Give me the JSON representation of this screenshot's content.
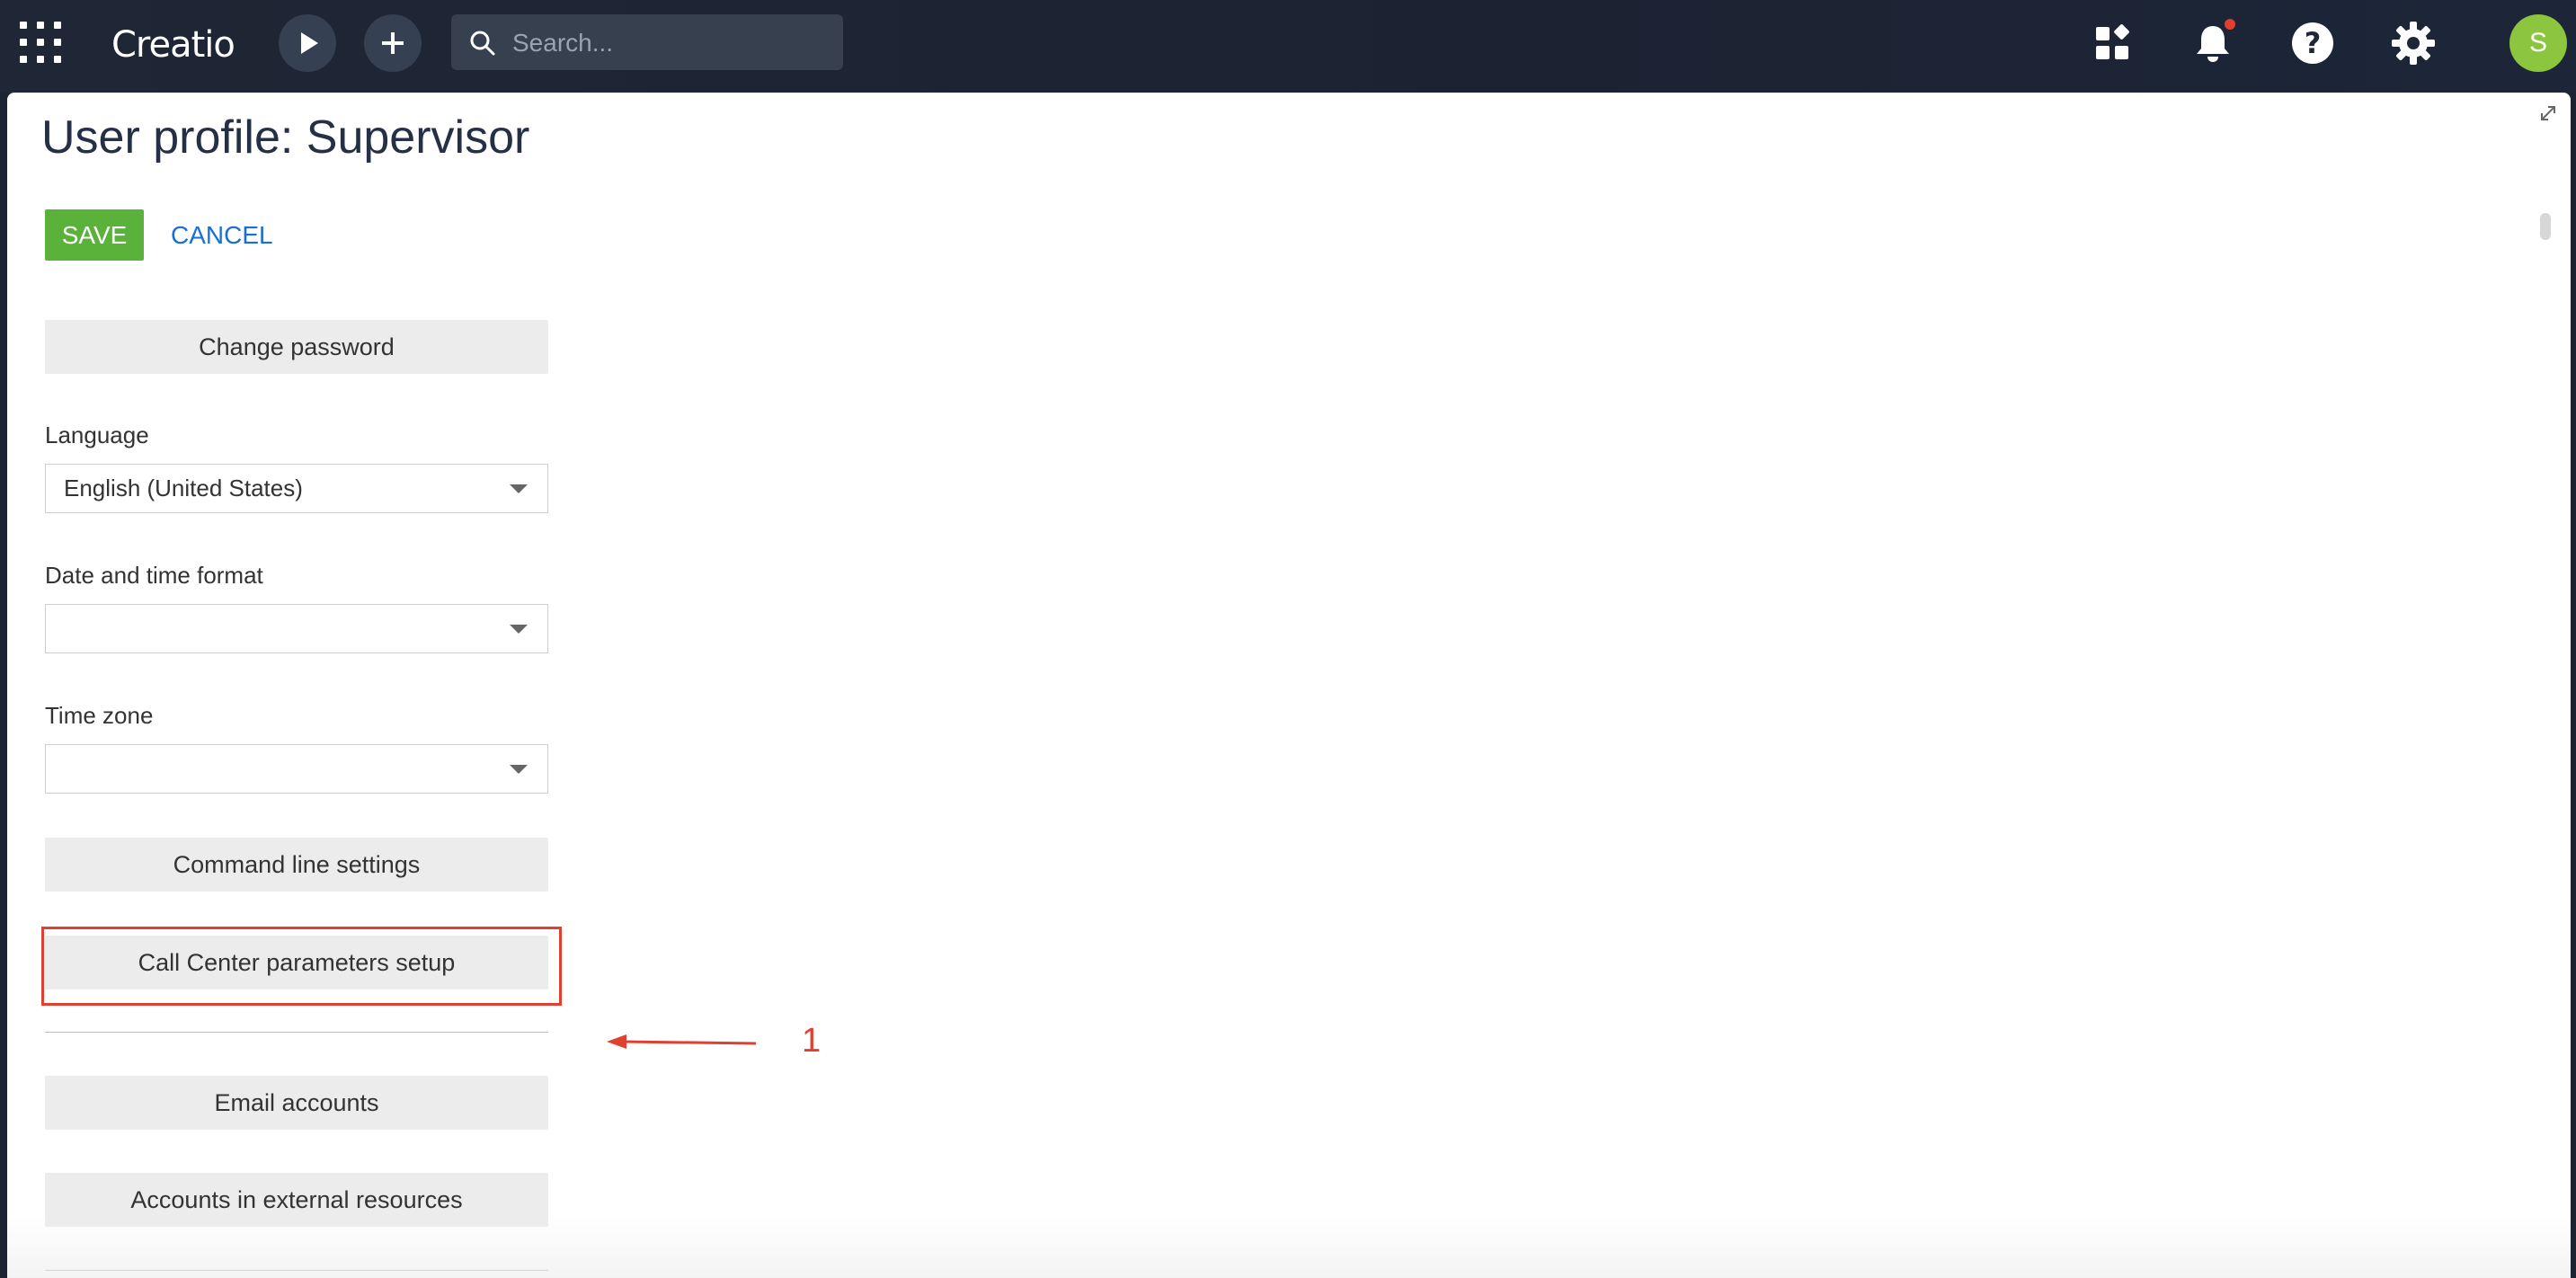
{
  "header": {
    "logo_text": "Creatio",
    "search_placeholder": "Search...",
    "avatar_initial": "S",
    "notification_dot_color": "#e0402f",
    "icons": [
      "apps-grid-icon",
      "play-icon",
      "plus-icon",
      "search-icon",
      "widgets-icon",
      "bell-icon",
      "help-icon",
      "gear-icon"
    ]
  },
  "page": {
    "title": "User profile: Supervisor",
    "save_label": "SAVE",
    "cancel_label": "CANCEL"
  },
  "profile": {
    "change_password_label": "Change password",
    "language": {
      "label": "Language",
      "value": "English (United States)"
    },
    "date_time_format": {
      "label": "Date and time format",
      "value": ""
    },
    "time_zone": {
      "label": "Time zone",
      "value": ""
    },
    "command_line_settings_label": "Command line settings",
    "call_center_setup_label": "Call Center parameters setup",
    "email_accounts_label": "Email accounts",
    "external_accounts_label": "Accounts in external resources"
  },
  "annotation": {
    "number": "1",
    "color": "#e0402f"
  },
  "colors": {
    "accent_green": "#5bb23b",
    "link_blue": "#1a6fd6",
    "avatar_green": "#8cc63f"
  }
}
